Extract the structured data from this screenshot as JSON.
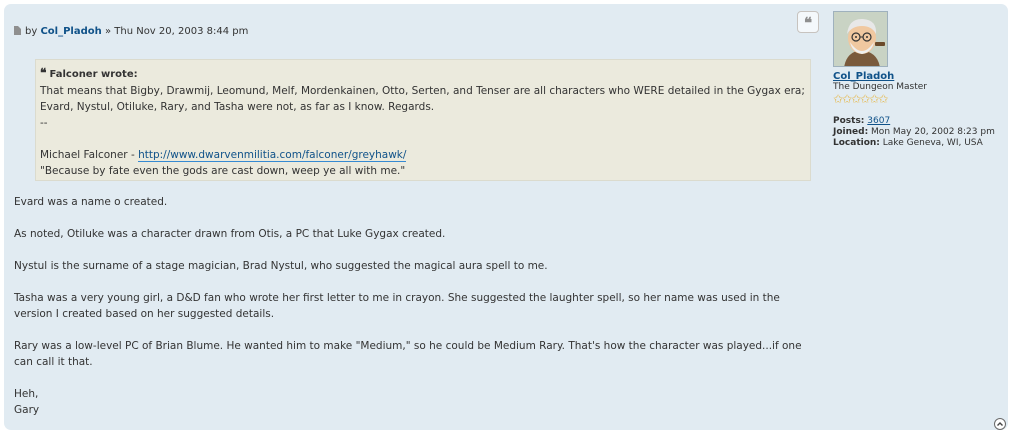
{
  "post": {
    "author_prefix": "by",
    "author": "Col_Pladoh",
    "separator": "»",
    "datetime": "Thu Nov 20, 2003 8:44 pm",
    "quote_button_glyph": "❝",
    "quote": {
      "cite": "Falconer wrote:",
      "text": "That means that Bigby, Drawmij, Leomund, Melf, Mordenkainen, Otto, Serten, and Tenser are all characters who WERE detailed in the Gygax era; Evard, Nystul, Otiluke, Rary, and Tasha were not, as far as I know. Regards.",
      "dashes": "--",
      "signature_name": "Michael Falconer -",
      "signature_url": "http://www.dwarvenmilitia.com/falconer/greyhawk/",
      "signature_motto": "\"Because by fate even the gods are cast down, weep ye all with me.\""
    },
    "paragraphs": [
      "Evard was a name o created.",
      "As noted, Otiluke was a character drawn from Otis, a PC that Luke Gygax created.",
      "Nystul is the surname of a stage magician, Brad Nystul, who suggested the magical aura spell to me.",
      "Tasha was a very young girl, a D&D fan who wrote her first letter to me in crayon. She suggested the laughter spell, so her name was used in the version I created based on her suggested details.",
      "Rary was a low-level PC of Brian Blume. He wanted him to make \"Medium,\" so he could be Medium Rary. That's how the character was played...if one can call it that."
    ],
    "signoff": [
      "Heh,",
      "Gary"
    ]
  },
  "profile": {
    "username": "Col_Pladoh",
    "rank": "The Dungeon Master",
    "stars": "✩✩✩✩✩✩",
    "posts_label": "Posts:",
    "posts_value": "3607",
    "joined_label": "Joined:",
    "joined_value": "Mon May 20, 2002 8:23 pm",
    "location_label": "Location:",
    "location_value": "Lake Geneva, WI, USA"
  },
  "colors": {
    "post_bg": "#e1ebf2",
    "quote_bg": "#ebeadd",
    "link": "#105289",
    "star": "#e6b84a"
  }
}
